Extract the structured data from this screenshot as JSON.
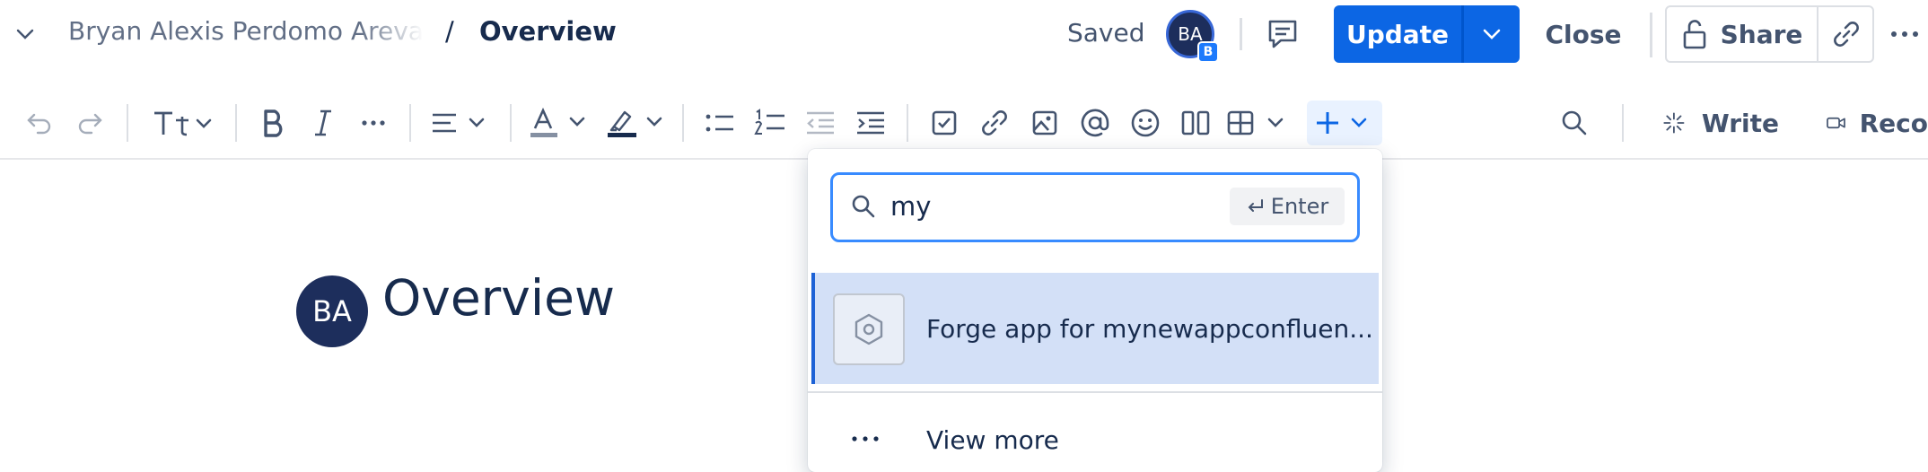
{
  "header": {
    "breadcrumb_parent": "Bryan Alexis Perdomo Arevalo",
    "breadcrumb_separator": "/",
    "breadcrumb_current": "Overview",
    "save_status": "Saved",
    "avatar_initials": "BA",
    "avatar_badge": "B",
    "update_label": "Update",
    "close_label": "Close",
    "share_label": "Share"
  },
  "toolbar": {
    "write_label": "Write",
    "record_label": "Reco"
  },
  "page": {
    "avatar_initials": "BA",
    "title": "Overview"
  },
  "insert_menu": {
    "search_value": "my",
    "enter_hint": "Enter",
    "results": [
      {
        "label": "Forge app for mynewappconfluen...",
        "icon": "forge-app-icon",
        "selected": true
      }
    ],
    "view_more_label": "View more"
  },
  "colors": {
    "primary": "#0c66e4",
    "selected_bg": "#d3e0f7",
    "focus_border": "#388bff",
    "avatar_bg": "#1d2e5c",
    "text": "#172b4d",
    "subtle_text": "#44546f"
  }
}
